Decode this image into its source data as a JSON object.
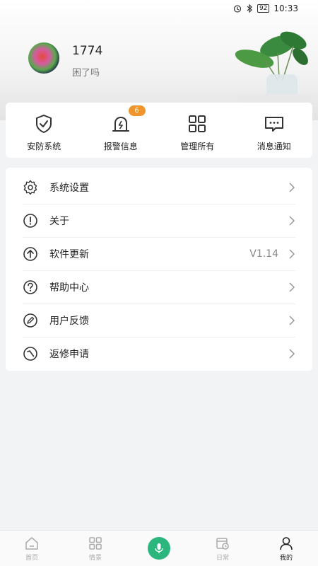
{
  "status": {
    "time": "10:33",
    "battery": "92",
    "alarm_icon": "alarm-icon",
    "bluetooth_icon": "bluetooth-icon"
  },
  "profile": {
    "name": "1774",
    "signature": "困了吗"
  },
  "quick": {
    "items": [
      {
        "label": "安防系统",
        "icon": "shield-check-icon"
      },
      {
        "label": "报警信息",
        "icon": "alarm-bell-icon",
        "badge": "6"
      },
      {
        "label": "管理所有",
        "icon": "grid-icon"
      },
      {
        "label": "消息通知",
        "icon": "message-icon"
      }
    ],
    "badge_color": "#f0952b"
  },
  "menu": {
    "items": [
      {
        "label": "系统设置",
        "icon": "gear-icon"
      },
      {
        "label": "关于",
        "icon": "info-icon"
      },
      {
        "label": "软件更新",
        "icon": "upload-icon",
        "value": "V1.14"
      },
      {
        "label": "帮助中心",
        "icon": "question-icon"
      },
      {
        "label": "用户反馈",
        "icon": "pencil-icon"
      },
      {
        "label": "返修申请",
        "icon": "repair-icon"
      }
    ]
  },
  "nav": {
    "items": [
      {
        "label": "首页",
        "icon": "home-icon"
      },
      {
        "label": "情景",
        "icon": "grid-icon"
      },
      {
        "label": "",
        "icon": "microphone-icon"
      },
      {
        "label": "日常",
        "icon": "calendar-clock-icon"
      },
      {
        "label": "我的",
        "icon": "user-icon",
        "active": true
      }
    ],
    "accent": "#2bb67e"
  }
}
